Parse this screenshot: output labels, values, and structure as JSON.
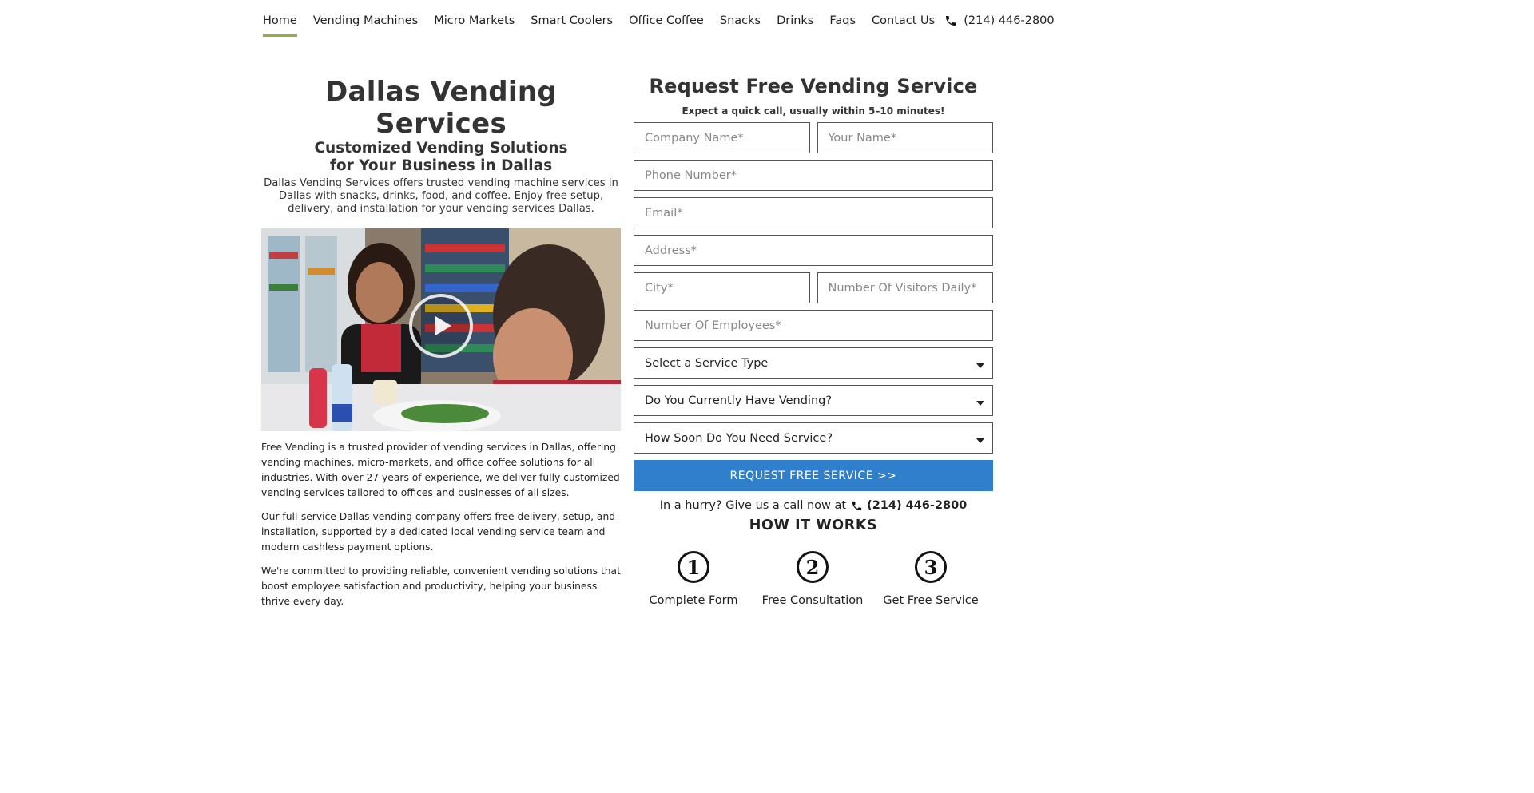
{
  "nav": {
    "items": [
      {
        "label": "Home",
        "active": true
      },
      {
        "label": "Vending Machines"
      },
      {
        "label": "Micro Markets"
      },
      {
        "label": "Smart Coolers"
      },
      {
        "label": "Office Coffee"
      },
      {
        "label": "Snacks"
      },
      {
        "label": "Drinks"
      },
      {
        "label": "Faqs"
      },
      {
        "label": "Contact Us"
      }
    ],
    "phone": "(214) 446-2800",
    "phone_icon": "phone-icon",
    "accent_color": "#8bb33a"
  },
  "hero": {
    "title": "Dallas Vending Services",
    "subtitle": "Customized Vending Solutions for Your Business in Dallas",
    "description": "Dallas Vending Services offers trusted vending machine services in Dallas with snacks, drinks, food, and coffee. Enjoy free setup, delivery, and installation for your vending services Dallas."
  },
  "video": {
    "play_icon": "play-icon"
  },
  "paragraphs": [
    "Free Vending is a trusted provider of vending services in Dallas, offering vending machines, micro-markets, and office coffee solutions for all industries. With over 27 years of experience, we deliver fully customized vending services tailored to offices and businesses of all sizes.",
    "Our full-service Dallas vending company offers free delivery, setup, and installation, supported by a dedicated local vending service team and modern cashless payment options.",
    "We're committed to providing reliable, convenient vending solutions that boost employee satisfaction and productivity, helping your business thrive every day."
  ],
  "form": {
    "title": "Request Free Vending Service",
    "tagline": "Expect a quick call, usually within 5–10 minutes!",
    "company_placeholder": "Company Name*",
    "name_placeholder": "Your Name*",
    "phone_placeholder": "Phone Number*",
    "email_placeholder": "Email*",
    "address_placeholder": "Address*",
    "city_placeholder": "City*",
    "visitors_placeholder": "Number Of Visitors Daily*",
    "employees_placeholder": "Number Of Employees*",
    "service_type": "Select a Service Type",
    "current_vending": "Do You Currently Have Vending?",
    "how_soon": "How Soon Do You Need Service?",
    "submit_label": "REQUEST FREE SERVICE >>",
    "button_color": "#2f7fcc",
    "hurry_text": "In a hurry? Give us a call now at",
    "hurry_phone": "(214) 446-2800"
  },
  "how": {
    "title": "HOW IT WORKS",
    "steps": [
      {
        "number": "1",
        "label": "Complete Form"
      },
      {
        "number": "2",
        "label": "Free Consultation"
      },
      {
        "number": "3",
        "label": "Get Free Service"
      }
    ]
  }
}
